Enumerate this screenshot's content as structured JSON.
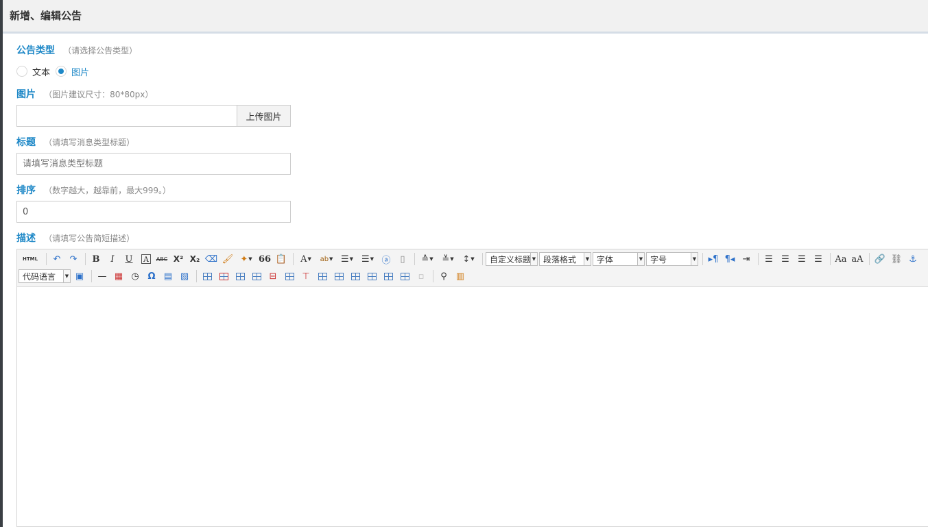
{
  "page": {
    "title": "新增、编辑公告"
  },
  "form": {
    "type": {
      "label": "公告类型",
      "hint": "（请选择公告类型）",
      "options": [
        {
          "label": "文本",
          "checked": false
        },
        {
          "label": "图片",
          "checked": true
        }
      ]
    },
    "image": {
      "label": "图片",
      "hint": "（图片建议尺寸：80*80px）",
      "value": "",
      "upload_label": "上传图片"
    },
    "title": {
      "label": "标题",
      "hint": "（请填写消息类型标题）",
      "placeholder": "请填写消息类型标题",
      "value": ""
    },
    "sort": {
      "label": "排序",
      "hint": "（数字越大，越靠前，最大999。）",
      "value": "0"
    },
    "description": {
      "label": "描述",
      "hint": "（请填写公告简短描述）"
    }
  },
  "editor": {
    "html_label": "HTML",
    "bold_label": "B",
    "italic_label": "I",
    "underline_label": "U",
    "strike_label": "ABC",
    "superscript_label": "X²",
    "subscript_label": "X₂",
    "quote_label": "66",
    "fontcolor_label": "A",
    "custom_heading": "自定义标题",
    "paragraph_format": "段落格式",
    "font_family": "字体",
    "font_size": "字号",
    "code_language": "代码语言",
    "omega_label": "Ω",
    "content": ""
  }
}
